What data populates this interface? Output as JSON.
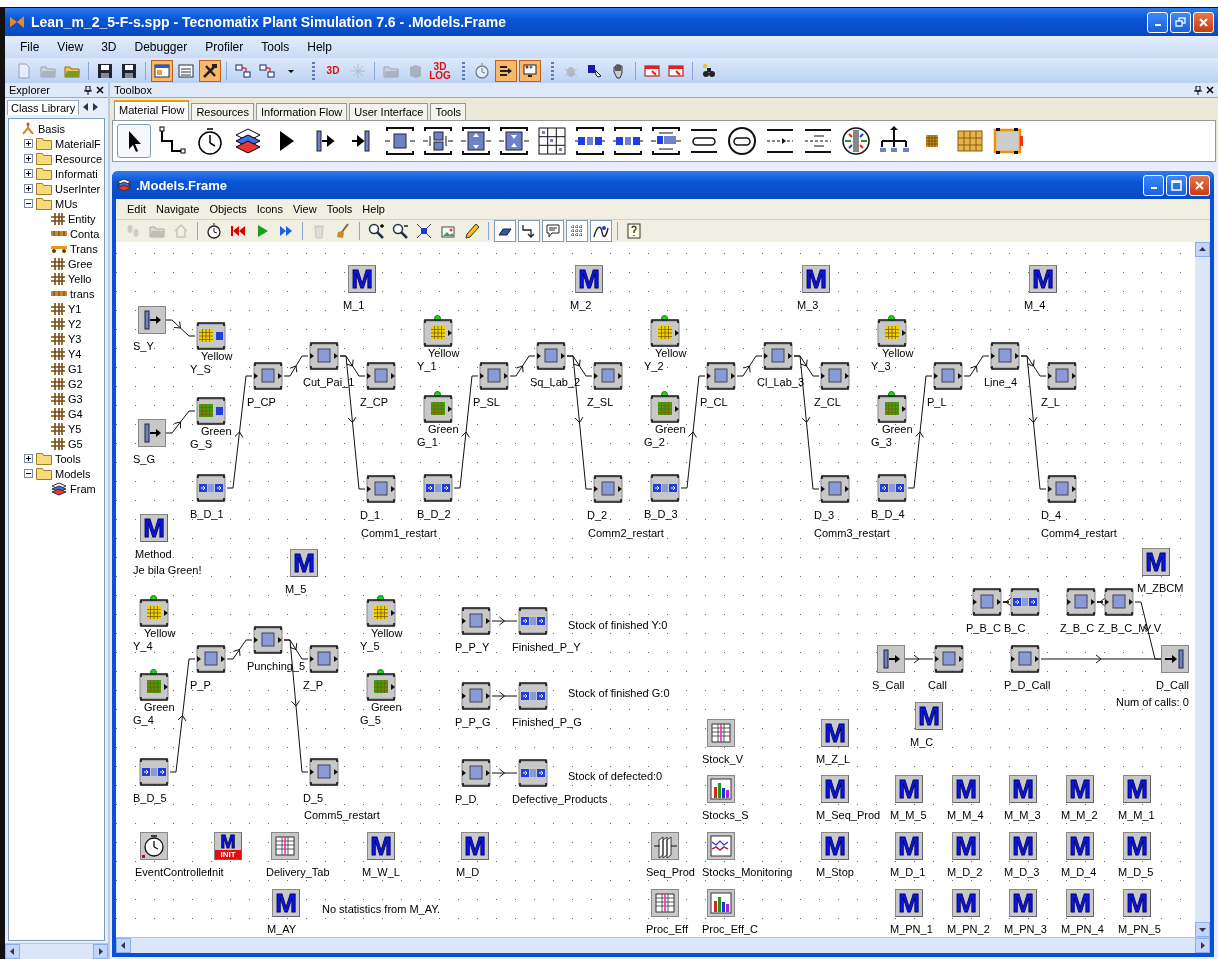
{
  "window": {
    "title": "Lean_m_2_5-F-s.spp - Tecnomatix Plant Simulation 7.6 - .Models.Frame"
  },
  "menu": [
    "File",
    "View",
    "3D",
    "Debugger",
    "Profiler",
    "Tools",
    "Help"
  ],
  "toolbar": [
    {
      "kind": "new-doc",
      "disabled": true,
      "on": false
    },
    {
      "kind": "folder",
      "disabled": true,
      "on": false
    },
    {
      "kind": "folder",
      "disabled": false,
      "on": false
    },
    {
      "kind": "separator"
    },
    {
      "kind": "save",
      "disabled": false,
      "on": false
    },
    {
      "kind": "save",
      "disabled": false,
      "on": false
    },
    {
      "kind": "separator"
    },
    {
      "kind": "window",
      "disabled": false,
      "on": true
    },
    {
      "kind": "list-window",
      "disabled": false,
      "on": false
    },
    {
      "kind": "tools",
      "disabled": false,
      "on": true
    },
    {
      "kind": "separator"
    },
    {
      "kind": "network",
      "disabled": false,
      "on": false
    },
    {
      "kind": "network",
      "disabled": false,
      "on": false
    },
    {
      "kind": "caret",
      "disabled": false,
      "on": false
    },
    {
      "kind": "grip"
    },
    {
      "kind": "label",
      "text": "3D",
      "disabled": false,
      "on": false
    },
    {
      "kind": "sparkle",
      "disabled": true,
      "on": false
    },
    {
      "kind": "separator"
    },
    {
      "kind": "folder",
      "disabled": true,
      "on": false
    },
    {
      "kind": "cube",
      "disabled": true,
      "on": false
    },
    {
      "kind": "label",
      "text": "3D LOG",
      "disabled": false,
      "on": false
    },
    {
      "kind": "grip"
    },
    {
      "kind": "clock",
      "disabled": true,
      "on": false
    },
    {
      "kind": "arrows",
      "disabled": false,
      "on": true
    },
    {
      "kind": "screen",
      "disabled": false,
      "on": true
    },
    {
      "kind": "grip"
    },
    {
      "kind": "bug",
      "disabled": true,
      "on": false
    },
    {
      "kind": "cursor-m",
      "disabled": false,
      "on": false
    },
    {
      "kind": "hand",
      "disabled": false,
      "on": false
    },
    {
      "kind": "separator"
    },
    {
      "kind": "red-window",
      "disabled": false,
      "on": false
    },
    {
      "kind": "red-window",
      "disabled": false,
      "on": false
    },
    {
      "kind": "separator"
    },
    {
      "kind": "binoculars",
      "disabled": false,
      "on": false
    }
  ],
  "explorer": {
    "title": "Explorer",
    "tab": "Class Library",
    "tree": [
      {
        "label": "Basis",
        "kind": "root",
        "children": [
          {
            "label": "MaterialF",
            "kind": "folder",
            "expanded": false
          },
          {
            "label": "Resource",
            "kind": "folder",
            "expanded": false
          },
          {
            "label": "Informati",
            "kind": "folder",
            "expanded": false
          },
          {
            "label": "UserInter",
            "kind": "folder",
            "expanded": false
          },
          {
            "label": "MUs",
            "kind": "folder",
            "expanded": true,
            "children": [
              {
                "label": "Entity",
                "kind": "entity"
              },
              {
                "label": "Conta",
                "kind": "container"
              },
              {
                "label": "Trans",
                "kind": "transporter"
              },
              {
                "label": "Gree",
                "kind": "entity"
              },
              {
                "label": "Yello",
                "kind": "entity"
              },
              {
                "label": "trans",
                "kind": "container"
              },
              {
                "label": "Y1",
                "kind": "entity"
              },
              {
                "label": "Y2",
                "kind": "entity"
              },
              {
                "label": "Y3",
                "kind": "entity"
              },
              {
                "label": "Y4",
                "kind": "entity"
              },
              {
                "label": "G1",
                "kind": "entity"
              },
              {
                "label": "G2",
                "kind": "entity"
              },
              {
                "label": "G3",
                "kind": "entity"
              },
              {
                "label": "G4",
                "kind": "entity"
              },
              {
                "label": "Y5",
                "kind": "entity"
              },
              {
                "label": "G5",
                "kind": "entity"
              }
            ]
          },
          {
            "label": "Tools",
            "kind": "folder",
            "expanded": false
          },
          {
            "label": "Models",
            "kind": "folder",
            "expanded": true,
            "children": [
              {
                "label": "Fram",
                "kind": "frame"
              }
            ]
          }
        ]
      }
    ]
  },
  "toolbox": {
    "title": "Toolbox",
    "tabs": [
      {
        "label": "Material Flow",
        "selected": true
      },
      {
        "label": "Resources",
        "selected": false
      },
      {
        "label": "Information Flow",
        "selected": false
      },
      {
        "label": "User Interface",
        "selected": false
      },
      {
        "label": "Tools",
        "selected": false
      }
    ],
    "tools": [
      {
        "kind": "pointer",
        "selected": true
      },
      {
        "kind": "connector",
        "selected": false
      },
      {
        "kind": "clock",
        "selected": false
      },
      {
        "kind": "layers",
        "selected": false
      },
      {
        "kind": "triangle",
        "selected": false
      },
      {
        "kind": "source",
        "selected": false
      },
      {
        "kind": "drain",
        "selected": false
      },
      {
        "kind": "station",
        "selected": false
      },
      {
        "kind": "parallel",
        "selected": false
      },
      {
        "kind": "assembly",
        "selected": false
      },
      {
        "kind": "dismantle",
        "selected": false
      },
      {
        "kind": "store",
        "selected": false
      },
      {
        "kind": "buffer",
        "selected": false
      },
      {
        "kind": "buffer",
        "selected": false
      },
      {
        "kind": "sorter",
        "selected": false
      },
      {
        "kind": "track",
        "selected": false
      },
      {
        "kind": "turn",
        "selected": false
      },
      {
        "kind": "line",
        "selected": false
      },
      {
        "kind": "twoline",
        "selected": false
      },
      {
        "kind": "turntable",
        "selected": false
      },
      {
        "kind": "flow",
        "selected": false
      },
      {
        "kind": "entity",
        "selected": false
      },
      {
        "kind": "container",
        "selected": false
      },
      {
        "kind": "transporter",
        "selected": false
      }
    ]
  },
  "frame": {
    "title": ".Models.Frame",
    "menu": [
      "Edit",
      "Navigate",
      "Objects",
      "Icons",
      "View",
      "Tools",
      "Help"
    ],
    "toolbar": [
      {
        "kind": "footprints",
        "disabled": true,
        "on": false
      },
      {
        "kind": "folder",
        "disabled": true,
        "on": false
      },
      {
        "kind": "home",
        "disabled": true,
        "on": false
      },
      {
        "kind": "separator"
      },
      {
        "kind": "clock",
        "disabled": false,
        "on": false
      },
      {
        "kind": "rewind",
        "disabled": false,
        "on": false
      },
      {
        "kind": "play",
        "disabled": false,
        "on": false
      },
      {
        "kind": "fast",
        "disabled": false,
        "on": false
      },
      {
        "kind": "separator"
      },
      {
        "kind": "trash",
        "disabled": true,
        "on": false
      },
      {
        "kind": "broom",
        "disabled": false,
        "on": false
      },
      {
        "kind": "separator"
      },
      {
        "kind": "zoom-in",
        "disabled": false,
        "on": false
      },
      {
        "kind": "zoom-out",
        "disabled": false,
        "on": false
      },
      {
        "kind": "fit",
        "disabled": false,
        "on": false
      },
      {
        "kind": "picture",
        "disabled": false,
        "on": false
      },
      {
        "kind": "pencil",
        "disabled": false,
        "on": false
      },
      {
        "kind": "separator"
      },
      {
        "kind": "eraser",
        "disabled": false,
        "on": true
      },
      {
        "kind": "connector",
        "disabled": false,
        "on": true
      },
      {
        "kind": "speech",
        "disabled": false,
        "on": true
      },
      {
        "kind": "grid",
        "disabled": false,
        "on": true
      },
      {
        "kind": "curve",
        "disabled": false,
        "on": true
      },
      {
        "kind": "separator"
      },
      {
        "kind": "help",
        "disabled": false,
        "on": false
      }
    ],
    "objects": [
      {
        "kind": "method",
        "glyph": "M",
        "label": "M_1"
      },
      {
        "kind": "method",
        "glyph": "M",
        "label": "M_2"
      },
      {
        "kind": "method",
        "glyph": "M",
        "label": "M_3"
      },
      {
        "kind": "method",
        "glyph": "M",
        "label": "M_4"
      },
      {
        "kind": "source",
        "label": "S_Y"
      },
      {
        "kind": "mu_buffer",
        "mu": "Yellow",
        "color": "#f0d000",
        "label": "Y_S"
      },
      {
        "kind": "source",
        "label": "S_G"
      },
      {
        "kind": "mu_buffer",
        "mu": "Green",
        "color": "#4a9a10",
        "label": "G_S"
      },
      {
        "kind": "buffer",
        "label": "B_D_1"
      },
      {
        "kind": "station",
        "label": "P_CP"
      },
      {
        "kind": "station",
        "label": "Cut_Pai_1"
      },
      {
        "kind": "station",
        "label": "Z_CP"
      },
      {
        "kind": "station",
        "label": "D_1"
      },
      {
        "kind": "mu_station",
        "mu": "Yellow",
        "color": "#f0d000",
        "led": true,
        "label": "Y_1"
      },
      {
        "kind": "mu_station",
        "mu": "Green",
        "color": "#4a9a10",
        "led": true,
        "label": "G_1"
      },
      {
        "kind": "buffer",
        "label": "B_D_2"
      },
      {
        "kind": "station",
        "label": "P_SL"
      },
      {
        "kind": "station",
        "label": "Sq_Lab_2"
      },
      {
        "kind": "station",
        "label": "Z_SL"
      },
      {
        "kind": "station",
        "label": "D_2"
      },
      {
        "kind": "mu_station",
        "mu": "Yellow",
        "color": "#f0d000",
        "led": true,
        "label": "Y_2"
      },
      {
        "kind": "mu_station",
        "mu": "Green",
        "color": "#4a9a10",
        "led": true,
        "label": "G_2"
      },
      {
        "kind": "buffer",
        "label": "B_D_3"
      },
      {
        "kind": "station",
        "label": "P_CL"
      },
      {
        "kind": "station",
        "label": "Cl_Lab_3"
      },
      {
        "kind": "station",
        "label": "Z_CL"
      },
      {
        "kind": "station",
        "label": "D_3"
      },
      {
        "kind": "mu_station",
        "mu": "Yellow",
        "color": "#f0d000",
        "led": true,
        "label": "Y_3"
      },
      {
        "kind": "mu_station",
        "mu": "Green",
        "color": "#4a9a10",
        "led": true,
        "label": "G_3"
      },
      {
        "kind": "buffer",
        "label": "B_D_4"
      },
      {
        "kind": "station",
        "label": "P_L"
      },
      {
        "kind": "station",
        "label": "Line_4"
      },
      {
        "kind": "station",
        "label": "Z_L"
      },
      {
        "kind": "station",
        "label": "D_4"
      },
      {
        "kind": "method",
        "glyph": "M",
        "label": "Method"
      },
      {
        "kind": "text",
        "label": "Comm1_restart"
      },
      {
        "kind": "text",
        "label": "Comm2_restart"
      },
      {
        "kind": "text",
        "label": "Comm3_restart"
      },
      {
        "kind": "text",
        "label": "Comm4_restart"
      },
      {
        "kind": "text",
        "label": "Je bila Green!"
      },
      {
        "kind": "method",
        "glyph": "M",
        "label": "M_5"
      },
      {
        "kind": "mu_station",
        "mu": "Yellow",
        "color": "#f0d000",
        "led": true,
        "label": "Y_4"
      },
      {
        "kind": "mu_station",
        "mu": "Yellow",
        "color": "#f0d000",
        "led": true,
        "label": "Y_5"
      },
      {
        "kind": "station",
        "label": "P_P"
      },
      {
        "kind": "station",
        "label": "Punching_5"
      },
      {
        "kind": "station",
        "label": "Z_P"
      },
      {
        "kind": "mu_station",
        "mu": "Green",
        "color": "#4a9a10",
        "led": true,
        "label": "G_4"
      },
      {
        "kind": "mu_station",
        "mu": "Green",
        "color": "#4a9a10",
        "led": true,
        "label": "G_5"
      },
      {
        "kind": "buffer",
        "label": "B_D_5"
      },
      {
        "kind": "station",
        "label": "D_5"
      },
      {
        "kind": "text",
        "label": "Comm5_restart"
      },
      {
        "kind": "station",
        "label": "P_P_Y"
      },
      {
        "kind": "buffer",
        "label": "Finished_P_Y"
      },
      {
        "kind": "text",
        "label": "Stock of finished Y:0"
      },
      {
        "kind": "station",
        "label": "P_P_G"
      },
      {
        "kind": "buffer",
        "label": "Finished_P_G"
      },
      {
        "kind": "text",
        "label": "Stock of finished G:0"
      },
      {
        "kind": "station",
        "label": "P_D"
      },
      {
        "kind": "buffer",
        "label": "Defective_Products"
      },
      {
        "kind": "text",
        "label": "Stock of defected:0"
      },
      {
        "kind": "method",
        "glyph": "M",
        "label": "M_ZBCM"
      },
      {
        "kind": "station",
        "label": "P_B_C"
      },
      {
        "kind": "buffer",
        "label": "B_C"
      },
      {
        "kind": "station",
        "label": "Z_B_C"
      },
      {
        "kind": "station",
        "label": "Z_B_C_M_V"
      },
      {
        "kind": "source",
        "label": "S_Call"
      },
      {
        "kind": "station",
        "label": "Call"
      },
      {
        "kind": "station",
        "label": "P_D_Call"
      },
      {
        "kind": "drain",
        "label": "D_Call"
      },
      {
        "kind": "text",
        "label": "Num of calls: 0"
      },
      {
        "kind": "method",
        "glyph": "M",
        "label": "M_C"
      },
      {
        "kind": "table",
        "label": "Stock_V"
      },
      {
        "kind": "method",
        "glyph": "M",
        "label": "M_Z_L"
      },
      {
        "kind": "chart",
        "label": "Stocks_S"
      },
      {
        "kind": "method",
        "glyph": "M",
        "label": "M_Seq_Prod"
      },
      {
        "kind": "method",
        "glyph": "M",
        "label": "M_M_5"
      },
      {
        "kind": "method",
        "glyph": "M",
        "label": "M_M_4"
      },
      {
        "kind": "method",
        "glyph": "M",
        "label": "M_M_3"
      },
      {
        "kind": "method",
        "glyph": "M",
        "label": "M_M_2"
      },
      {
        "kind": "method",
        "glyph": "M",
        "label": "M_M_1"
      },
      {
        "kind": "event",
        "label": "EventController"
      },
      {
        "kind": "init",
        "glyph": "M",
        "badge": "INIT",
        "label": "Init"
      },
      {
        "kind": "table",
        "label": "Delivery_Tab"
      },
      {
        "kind": "method",
        "glyph": "M",
        "label": "M_W_L"
      },
      {
        "kind": "method",
        "glyph": "M",
        "label": "M_D"
      },
      {
        "kind": "generator",
        "label": "Seq_Prod"
      },
      {
        "kind": "plot",
        "label": "Stocks_Monitoring"
      },
      {
        "kind": "method",
        "glyph": "M",
        "label": "M_Stop"
      },
      {
        "kind": "method",
        "glyph": "M",
        "label": "M_D_1"
      },
      {
        "kind": "method",
        "glyph": "M",
        "label": "M_D_2"
      },
      {
        "kind": "method",
        "glyph": "M",
        "label": "M_D_3"
      },
      {
        "kind": "method",
        "glyph": "M",
        "label": "M_D_4"
      },
      {
        "kind": "method",
        "glyph": "M",
        "label": "M_D_5"
      },
      {
        "kind": "method",
        "glyph": "M",
        "label": "M_AY"
      },
      {
        "kind": "text",
        "label": "No statistics from M_AY."
      },
      {
        "kind": "table",
        "label": "Proc_Eff"
      },
      {
        "kind": "chart",
        "label": "Proc_Eff_C"
      },
      {
        "kind": "method",
        "glyph": "M",
        "label": "M_PN_1"
      },
      {
        "kind": "method",
        "glyph": "M",
        "label": "M_PN_2"
      },
      {
        "kind": "method",
        "glyph": "M",
        "label": "M_PN_3"
      },
      {
        "kind": "method",
        "glyph": "M",
        "label": "M_PN_4"
      },
      {
        "kind": "method",
        "glyph": "M",
        "label": "M_PN_5"
      }
    ]
  }
}
